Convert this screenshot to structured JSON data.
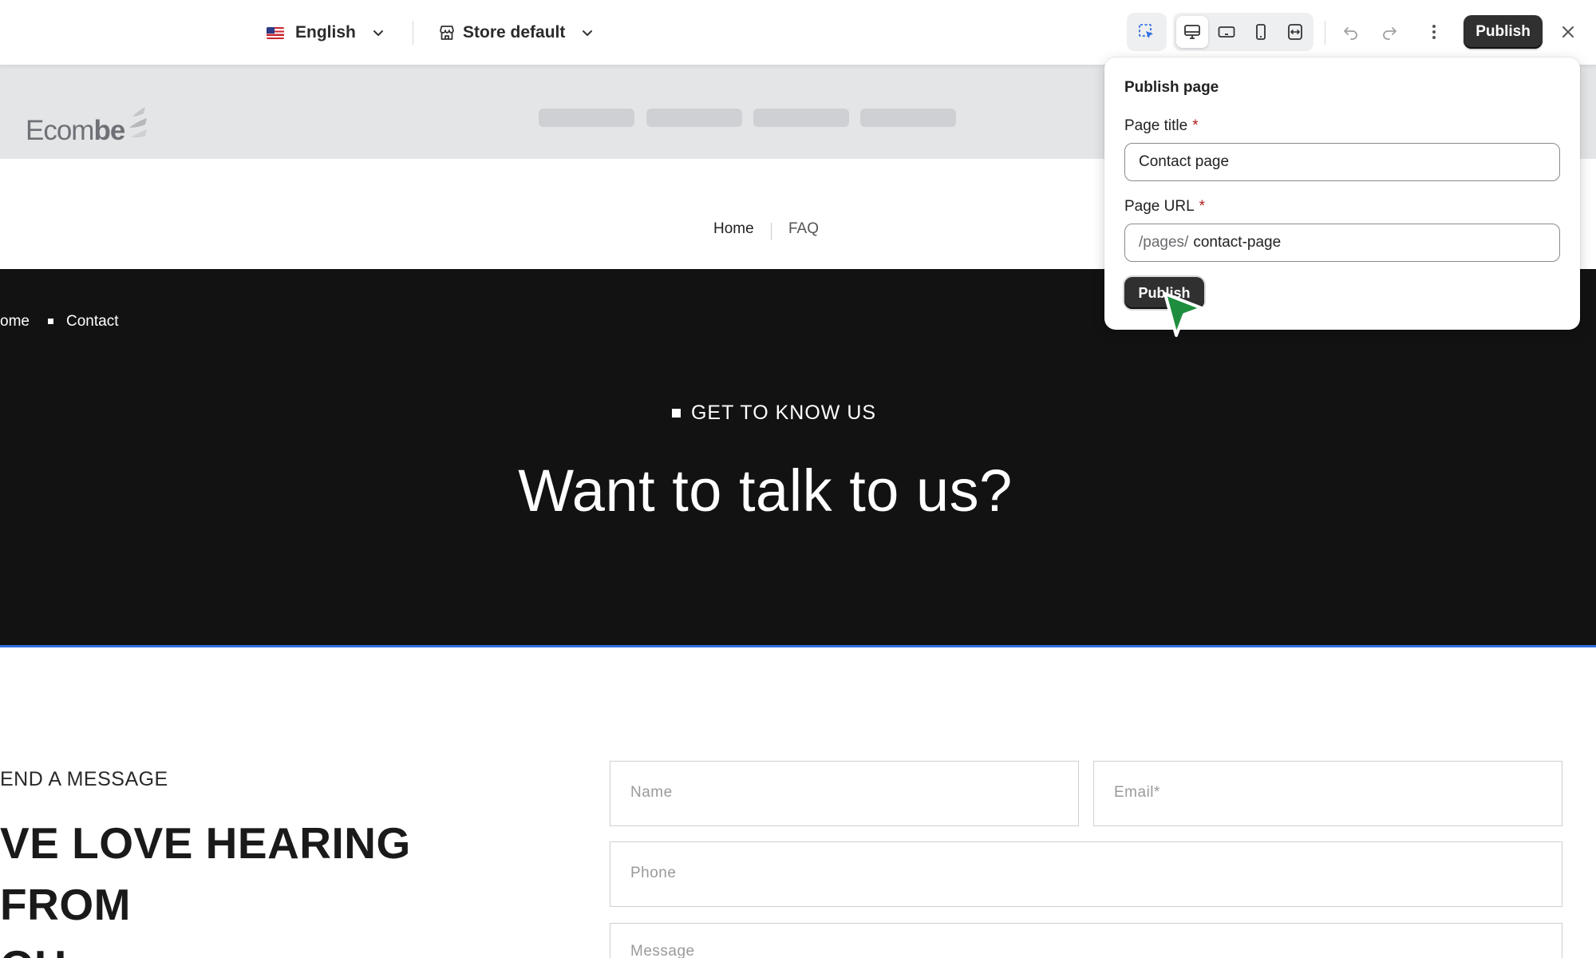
{
  "toolbar": {
    "language": "English",
    "language_flag": "us-flag-icon",
    "store": "Store default",
    "publish_label": "Publish",
    "icons": [
      "select-element-icon",
      "desktop-view-icon",
      "tablet-view-icon",
      "mobile-view-icon",
      "fit-width-icon",
      "undo-icon",
      "redo-icon",
      "more-options-icon",
      "close-icon"
    ]
  },
  "store_header": {
    "logo_text_light": "Ecom",
    "logo_text_bold": "be"
  },
  "subnav": {
    "home": "Home",
    "faq": "FAQ"
  },
  "hero": {
    "breadcrumb_home": "ome",
    "breadcrumb_current": "Contact",
    "eyebrow": "GET TO KNOW US",
    "title": "Want to talk to us?",
    "background": "#121212"
  },
  "contact": {
    "eyebrow": "END A MESSAGE",
    "title": "VE LOVE HEARING FROM OU",
    "title_line1": "VE LOVE HEARING FROM",
    "title_line2": "OU",
    "name_placeholder": "Name",
    "email_placeholder": "Email*",
    "phone_placeholder": "Phone",
    "message_placeholder": "Message"
  },
  "popover": {
    "title": "Publish page",
    "page_title_label": "Page title",
    "page_title_value": "Contact page",
    "page_url_label": "Page URL",
    "page_url_prefix": "/pages/",
    "page_url_value": "contact-page",
    "required_mark": "*",
    "publish_label": "Publish"
  },
  "colors": {
    "accent_dark": "#303030",
    "selection_blue": "#2f6fe0",
    "required_red": "#b11d1d",
    "cursor_green": "#1e8e3e"
  }
}
